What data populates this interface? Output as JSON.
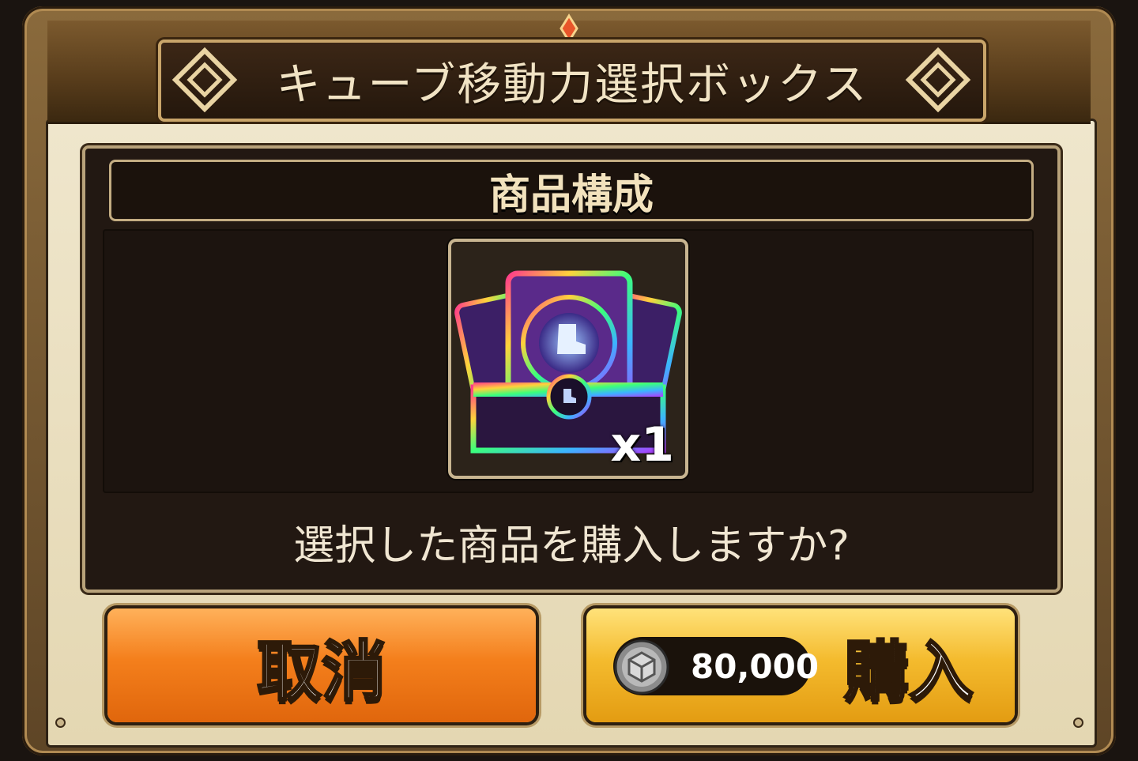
{
  "dialog": {
    "title": "キューブ移動力選択ボックス",
    "section_header": "商品構成",
    "item": {
      "icon": "rainbow-chest-boot-icon",
      "quantity": "x1"
    },
    "question": "選択した商品を購入しますか?",
    "cancel_button": {
      "label": "取消"
    },
    "buy_button": {
      "label": "購入",
      "price": "80,000",
      "currency_icon": "silver-coin-icon"
    }
  },
  "colors": {
    "frame_gold": "#c9a56a",
    "parchment": "#efe6cc",
    "panel_dark": "#221812",
    "cancel_orange": "#f47f1c",
    "buy_yellow": "#f4bb2e"
  }
}
